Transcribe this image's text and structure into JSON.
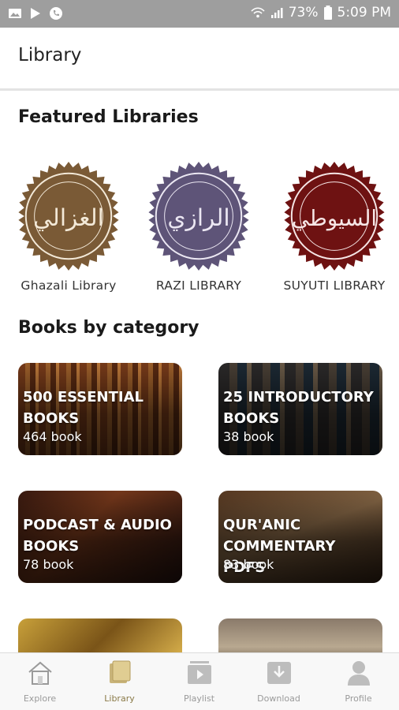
{
  "status_bar": {
    "battery": "73%",
    "time": "5:09 PM"
  },
  "app_bar": {
    "title": "Library"
  },
  "featured": {
    "title": "Featured Libraries",
    "libraries": [
      {
        "label": "Ghazali Library",
        "seal_text": "الغزالي",
        "color": "#7a5a36"
      },
      {
        "label": "RAZI  LIBRARY",
        "seal_text": "الرازي",
        "color": "#5e5478"
      },
      {
        "label": "SUYUTI  LIBRARY",
        "seal_text": "السيوطي",
        "color": "#6e1212"
      }
    ]
  },
  "categories": {
    "title": "Books by category",
    "items": [
      {
        "title": "500 ESSENTIAL BOOKS",
        "count": "464 book"
      },
      {
        "title": "25 INTRODUCTORY BOOKS",
        "count": "38 book"
      },
      {
        "title": "PODCAST & AUDIO BOOKS",
        "count": "78 book"
      },
      {
        "title": "QUR'ANIC COMMENTARY PDFS",
        "count": "83 book"
      }
    ]
  },
  "bottom_nav": {
    "items": [
      {
        "label": "Explore",
        "icon": "home-icon"
      },
      {
        "label": "Library",
        "icon": "library-icon",
        "active": true
      },
      {
        "label": "Playlist",
        "icon": "playlist-icon"
      },
      {
        "label": "Download",
        "icon": "download-icon"
      },
      {
        "label": "Profile",
        "icon": "profile-icon"
      }
    ]
  }
}
